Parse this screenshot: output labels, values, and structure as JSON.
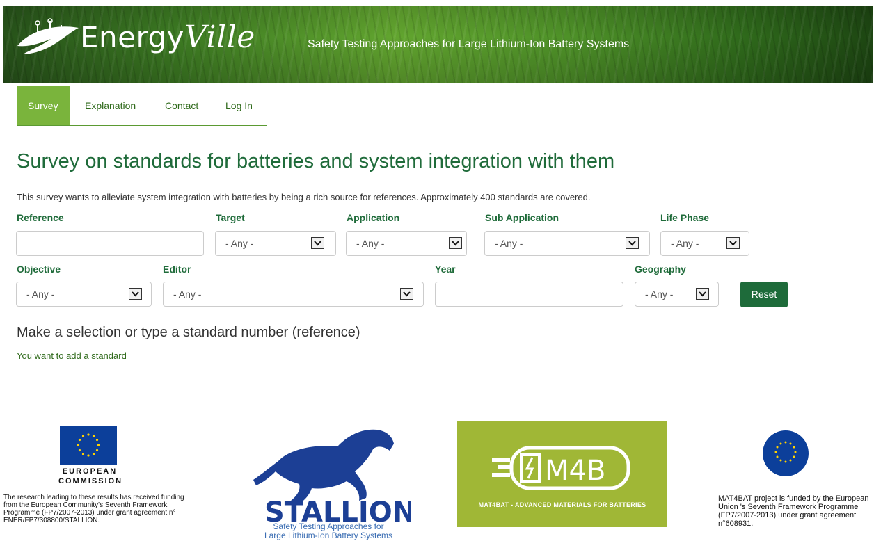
{
  "header": {
    "logo_main": "Energy",
    "logo_accent": "Ville",
    "tagline": "Safety Testing Approaches for Large Lithium-Ion Battery Systems"
  },
  "nav": {
    "tabs": [
      {
        "label": "Survey",
        "active": true
      },
      {
        "label": "Explanation",
        "active": false
      },
      {
        "label": "Contact",
        "active": false
      },
      {
        "label": "Log In",
        "active": false
      }
    ]
  },
  "main": {
    "title": "Survey on standards for batteries and system integration with them",
    "intro": "This survey wants to alleviate system integration with batteries by being a rich source for references. Approximately 400 standards are covered.",
    "filters": {
      "reference": {
        "label": "Reference",
        "value": ""
      },
      "target": {
        "label": "Target",
        "value": "- Any -"
      },
      "application": {
        "label": "Application",
        "value": "- Any -"
      },
      "sub_application": {
        "label": "Sub Application",
        "value": "- Any -"
      },
      "life_phase": {
        "label": "Life Phase",
        "value": "- Any -"
      },
      "objective": {
        "label": "Objective",
        "value": "- Any -"
      },
      "editor": {
        "label": "Editor",
        "value": "- Any -"
      },
      "year": {
        "label": "Year",
        "value": ""
      },
      "geography": {
        "label": "Geography",
        "value": "- Any -"
      }
    },
    "reset_label": "Reset",
    "prompt": "Make a selection or type a standard number (reference)",
    "add_link": "You want to add a standard"
  },
  "footer": {
    "ec_name_line1": "EUROPEAN",
    "ec_name_line2": "COMMISSION",
    "ec_note": "The research leading to these results has received funding from the European Community's Seventh Framework Programme (FP7/2007-2013) under grant agreement n° ENER/FP7/308800/STALLION.",
    "stallion_word": "STALLION",
    "stallion_sub_line1": "Safety Testing Approaches for",
    "stallion_sub_line2": "Large Lithium-Ion Battery Systems",
    "m4b_word": "M4B",
    "m4b_sub": "MAT4BAT - ADVANCED MATERIALS FOR BATTERIES",
    "eu_note": "MAT4BAT project is funded by the European Union 's Seventh Framework Programme (FP7/2007-2013) under grant agreement n°608931."
  },
  "colors": {
    "brand_green": "#1f6b3a",
    "nav_active": "#7ab43c",
    "reset_button": "#1e6b3a",
    "link_green": "#2f6a1b",
    "eu_blue": "#0c3f9a",
    "m4b_green": "#a0b736",
    "stallion_blue": "#1c3f95"
  }
}
